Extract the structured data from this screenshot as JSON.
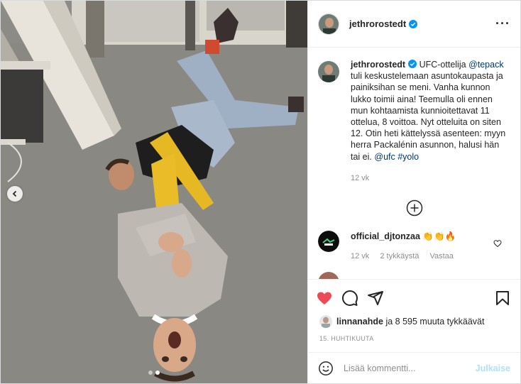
{
  "post": {
    "author": "jethrorostedt",
    "caption": {
      "author": "jethrorostedt",
      "text_1": "UFC-ottelija",
      "mention_1": "@tepack",
      "text_2": "tuli keskustelemaan asuntokaupasta ja painiksihan se meni. Vanha kunnon lukko toimii aina! Teemulla oli ennen mun kohtaamista kunnioitettavat 11 ottelua, 8 voittoa. Nyt otteluita on siten 12. Otin heti kättelyssä asenteen: myyn herra Packalénin asunnon, halusi hän tai ei.",
      "mention_2": "@ufc",
      "hashtag": "#yolo",
      "age": "12 vk"
    },
    "comments": [
      {
        "author": "official_djtonzaa",
        "text": "👏👏🔥",
        "age": "12 vk",
        "likes": "2 tykkäystä",
        "reply": "Vastaa"
      }
    ],
    "likes": {
      "liker": "linnanahde",
      "rest": "ja 8 595 muuta tykkäävät"
    },
    "date": "15. HUHTIKUUTA",
    "input_placeholder": "Lisää kommentti...",
    "publish_label": "Julkaise",
    "more_label": "···"
  },
  "icons": {
    "verified": "verified-badge-icon",
    "more": "more-options-icon",
    "load_more": "plus-circle-icon",
    "like": "heart-icon",
    "comment": "comment-icon",
    "share": "share-icon",
    "save": "bookmark-icon",
    "emoji": "emoji-icon",
    "prev": "chevron-left-icon"
  },
  "carousel": {
    "slides": 2,
    "active": 2
  },
  "colors": {
    "verified": "#0095f6",
    "liked": "#ed4956",
    "link": "#00376b",
    "muted": "#8e8e8e",
    "publish_disabled": "#b2dffc"
  }
}
